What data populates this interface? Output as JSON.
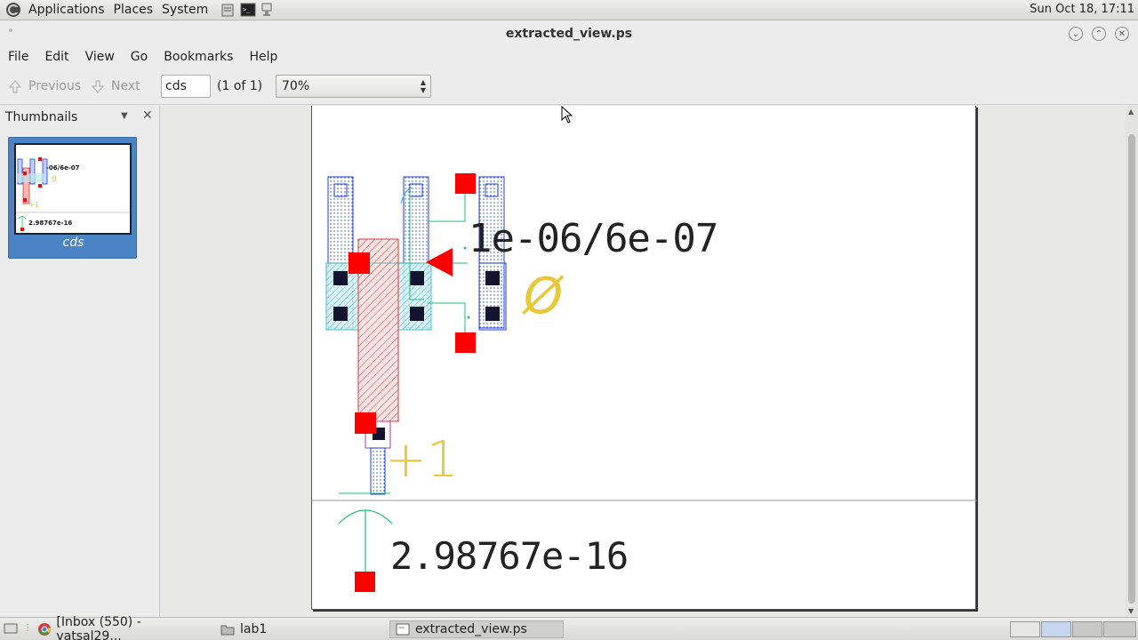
{
  "top_panel": {
    "menus": [
      "Applications",
      "Places",
      "System"
    ],
    "clock": "Sun Oct 18, 17:11"
  },
  "window": {
    "title": "extracted_view.ps"
  },
  "menubar": [
    "File",
    "Edit",
    "View",
    "Go",
    "Bookmarks",
    "Help"
  ],
  "toolbar": {
    "previous_label": "Previous",
    "next_label": "Next",
    "page_input_value": "cds",
    "page_count": "(1 of 1)",
    "zoom_value": "70%"
  },
  "sidebar": {
    "header": "Thumbnails",
    "thumbnail_label": "cds",
    "thumb_text_top": "-06/6e-07",
    "thumb_text_bottom": "2.98767e-16",
    "thumb_text_0": "0",
    "thumb_text_1": "+1"
  },
  "document": {
    "label_size": "1e-06/6e-07",
    "label_zero": "Ø",
    "label_plus_one": "+1",
    "label_cap": "2.98767e-16",
    "colors": {
      "poly": "#d93a3a",
      "metal": "#1f3fd6",
      "diff": "#2bb3c0",
      "pin": "#ff0000",
      "contact": "#141430",
      "wire": "#1fbf7f",
      "yellow_text": "#e6c83a"
    }
  },
  "taskbar": {
    "items": [
      "[Inbox (550) - vatsal29...",
      "lab1",
      "extracted_view.ps"
    ]
  }
}
